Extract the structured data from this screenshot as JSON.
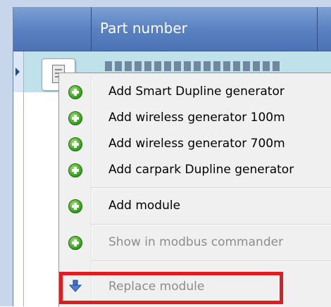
{
  "grid": {
    "header": {
      "part_number_label": "Part number"
    },
    "row": {
      "selected": true
    }
  },
  "context_menu": {
    "items": [
      {
        "label": "Add Smart Dupline generator",
        "icon": "add-plus-icon",
        "enabled": true
      },
      {
        "label": "Add wireless generator 100m",
        "icon": "add-plus-icon",
        "enabled": true
      },
      {
        "label": "Add wireless generator 700m",
        "icon": "add-plus-icon",
        "enabled": true
      },
      {
        "label": "Add carpark Dupline generator",
        "icon": "add-plus-icon",
        "enabled": true
      },
      {
        "label": "Add module",
        "icon": "add-plus-icon",
        "enabled": true
      },
      {
        "label": "Show in modbus commander",
        "icon": "add-plus-icon",
        "enabled": false
      },
      {
        "label": "Replace module",
        "icon": "arrow-down-icon",
        "enabled": false
      }
    ],
    "highlighted_item": "Replace module"
  },
  "colors": {
    "header_blue": "#5a82c2",
    "row_selected": "#bfe2ea",
    "menu_background": "#f0f0f0",
    "highlight_red": "#e11b22",
    "disabled_text": "#8d8d8d"
  }
}
